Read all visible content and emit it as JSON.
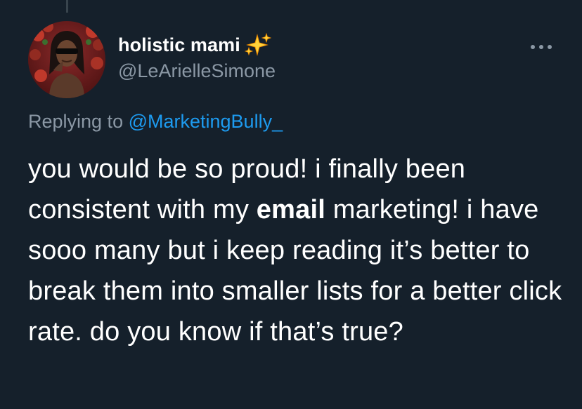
{
  "author": {
    "display_name": "holistic mami",
    "display_name_emoji": "sparkles-icon",
    "handle": "@LeArielleSimone"
  },
  "reply": {
    "prefix": "Replying to ",
    "mention": "@MarketingBully_"
  },
  "tweet": {
    "text_before": "you would be so proud! i finally been consistent with my ",
    "text_bold": "email",
    "text_after": " marketing! i have sooo many but i keep reading it’s better to break them into smaller lists for a better click rate. do you know if that’s true?"
  },
  "colors": {
    "background": "#15202b",
    "text_primary": "#ffffff",
    "text_secondary": "#8b98a5",
    "link": "#1d9bf0",
    "sparkle": "#ffd43b"
  },
  "icons": {
    "more": "more-horizontal-icon",
    "sparkles": "sparkles-icon"
  }
}
